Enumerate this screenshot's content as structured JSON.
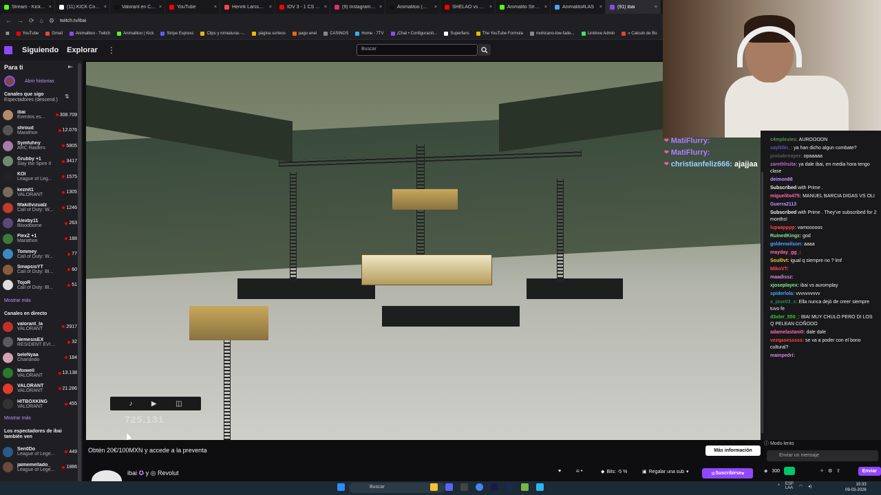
{
  "tabs": [
    {
      "title": "Stream - Kick Da",
      "color": "#53fc18"
    },
    {
      "title": "(11) KICK Comme",
      "color": "#ffffff"
    },
    {
      "title": "Valorant en Chile",
      "color": "#111111"
    },
    {
      "title": "YouTube",
      "color": "#ff0000"
    },
    {
      "title": "Henrik Larsson s",
      "color": "#ff4444"
    },
    {
      "title": "IDV 3 - 1 CS Mu",
      "color": "#ff0000"
    },
    {
      "title": "(9) Instagram • M",
      "color": "#e1306c"
    },
    {
      "title": "Animalitoo (@an",
      "color": "#111111"
    },
    {
      "title": "SHELAO vs CUAR",
      "color": "#ff0000"
    },
    {
      "title": "Animalito Stream",
      "color": "#53fc18"
    },
    {
      "title": "Animalito#LAS",
      "color": "#4aa3ff"
    },
    {
      "title": "(91) ibai",
      "color": "#9147ff"
    }
  ],
  "url": "twitch.tv/ibai",
  "bookmarks": [
    {
      "label": "YouTube",
      "color": "#ff0000"
    },
    {
      "label": "Gmail",
      "color": "#ea4335"
    },
    {
      "label": "Animalitoo - Twitch",
      "color": "#9147ff"
    },
    {
      "label": "Animalitoo | Kick",
      "color": "#53fc18"
    },
    {
      "label": "Stripe Express",
      "color": "#635bff"
    },
    {
      "label": "Clips y miniaturas -...",
      "color": "#f4b400"
    },
    {
      "label": "página sorteos",
      "color": "#f4b400"
    },
    {
      "label": "pago enel",
      "color": "#ff6600"
    },
    {
      "label": "CASINOS",
      "color": "#888888"
    },
    {
      "label": "Home - 7TV",
      "color": "#29b6f6"
    },
    {
      "label": "¡Chat • Configuració...",
      "color": "#9147ff"
    },
    {
      "label": "Superfans",
      "color": "#ffffff"
    },
    {
      "label": "The YouTube Formula",
      "color": "#f4b400"
    },
    {
      "label": "mohicano-low-fade...",
      "color": "#888888"
    },
    {
      "label": "Linktree Admin",
      "color": "#43e660"
    },
    {
      "label": "« Calculo de Bo",
      "color": "#ea4335"
    }
  ],
  "nav": {
    "following": "Siguiendo",
    "explore": "Explorar",
    "search_placeholder": "Buscar"
  },
  "sidebar": {
    "for_you": "Para ti",
    "open_stories": "Abrir historias",
    "followed_title": "Canales que sigo",
    "followed_sort": "Espectadores (descend.)",
    "followed": [
      {
        "name": "ibai",
        "game": "Eventos es...",
        "viewers": "308.709",
        "color": "#b38a6a"
      },
      {
        "name": "shroud",
        "game": "Marathon",
        "viewers": "12.076",
        "color": "#555555"
      },
      {
        "name": "Symfuhny",
        "game": "ARC Raiders",
        "viewers": "5805",
        "color": "#a87ca8"
      },
      {
        "name": "Grubby +1",
        "game": "Slay the Spire II",
        "viewers": "3417",
        "color": "#6e8c6e"
      },
      {
        "name": "KOI",
        "game": "League of Leg...",
        "viewers": "1575",
        "color": "#222222"
      },
      {
        "name": "keznit1",
        "game": "VALORANT",
        "viewers": "1305",
        "color": "#7a6a5a"
      },
      {
        "name": "fifakillvizualz",
        "game": "Call of Duty: W...",
        "viewers": "1246",
        "color": "#c23b2b"
      },
      {
        "name": "Alexby11",
        "game": "Bloodborne",
        "viewers": "263",
        "color": "#5a4a7a"
      },
      {
        "name": "FlexZ +1",
        "game": "Marathon",
        "viewers": "188",
        "color": "#3a7a3a"
      },
      {
        "name": "Tommey",
        "game": "Call of Duty: W...",
        "viewers": "77",
        "color": "#3a8ac2"
      },
      {
        "name": "SinapsisYT",
        "game": "Call of Duty: Bl...",
        "viewers": "60",
        "color": "#8a5a3a"
      },
      {
        "name": "TojoR",
        "game": "Call of Duty: Bl...",
        "viewers": "51",
        "color": "#dddddd"
      }
    ],
    "show_more": "Mostrar más",
    "live_title": "Canales en directo",
    "live": [
      {
        "name": "valorant_la",
        "game": "VALORANT",
        "viewers": "2917",
        "color": "#c2302b"
      },
      {
        "name": "NemesisEX",
        "game": "RESIDENT EVIL...",
        "viewers": "32",
        "color": "#5a5a5a"
      },
      {
        "name": "beleNyaa",
        "game": "Charlando",
        "viewers": "184",
        "color": "#d4a2b8"
      },
      {
        "name": "Mixwell",
        "game": "VALORANT",
        "viewers": "13.138",
        "color": "#2a7a2a"
      },
      {
        "name": "VALORANT",
        "game": "VALORANT",
        "viewers": "21.286",
        "color": "#e6392b"
      },
      {
        "name": "HITBOXKING",
        "game": "VALORANT",
        "viewers": "455",
        "color": "#333333"
      }
    ],
    "show_more2": "Mostrar más",
    "viewers_like": "Los espectadores de ibai también ven",
    "suggested": [
      {
        "name": "Sen0Do",
        "game": "League of Lege...",
        "viewers": "449",
        "color": "#2a5a8a"
      },
      {
        "name": "jaimemellado_",
        "game": "League of Lege...",
        "viewers": "1886",
        "color": "#6a4a3a"
      }
    ]
  },
  "overlay": {
    "count": "725.131"
  },
  "alerts": [
    {
      "user": "MatiFlurry:",
      "msg": "",
      "color": "#b57bff"
    },
    {
      "user": "MatiFlurry:",
      "msg": "",
      "color": "#b57bff"
    },
    {
      "user": "christianfeliz666:",
      "msg": "ajajjaa",
      "color": "#9ad1ff"
    }
  ],
  "chat": [
    {
      "user": "c4mplexies:",
      "text": "AUROOOON",
      "ucolor": "#5a8a5a"
    },
    {
      "user": "sayltilin_:",
      "text": "ya han dicho algun combate?",
      "ucolor": "#5a5aa8"
    },
    {
      "user": "joobabreaper:",
      "text": "opaaaaa",
      "ucolor": "#5a5a5a"
    },
    {
      "user": "zarethhsita:",
      "text": "ya dale ibai, en media hora tengo clase",
      "ucolor": "#b86ec7"
    },
    {
      "user": "deimon88",
      "text": "",
      "ucolor": "#bf94ff"
    },
    {
      "user": "Subscribed",
      "text": "with Prime .",
      "ucolor": "#efeff1"
    },
    {
      "user": "miguelito475:",
      "text": "MANUEL BARCIA DIGAS VS OLI",
      "ucolor": "#ff69b4"
    },
    {
      "user": "Guerra2113",
      "text": "",
      "ucolor": "#bf94ff"
    },
    {
      "user": "Subscribed",
      "text": "with Prime . They've subscribed for 2 months!",
      "ucolor": "#efeff1"
    },
    {
      "user": "lupaapppp:",
      "text": "vamooooos",
      "ucolor": "#ff4444"
    },
    {
      "user": "RuinedKingz:",
      "text": "god",
      "ucolor": "#8be68b"
    },
    {
      "user": "goldenwilson:",
      "text": "aaaa",
      "ucolor": "#4aa3ff"
    },
    {
      "user": "mayday_gg_:",
      "text": "",
      "ucolor": "#ff69b4"
    },
    {
      "user": "Soul0vt:",
      "text": "igual q siempre no ? lmf",
      "ucolor": "#f4c430"
    },
    {
      "user": "MikoVT:",
      "text": "",
      "ucolor": "#ff4444"
    },
    {
      "user": "maadissz:",
      "text": "",
      "ucolor": "#d48ad4"
    },
    {
      "user": "xjoseplayex:",
      "text": "ibai vs auromplay",
      "ucolor": "#8be68b"
    },
    {
      "user": "spiderlola:",
      "text": "vvvvvvvvvv",
      "ucolor": "#4aa3ff"
    },
    {
      "user": "x_jose03_x:",
      "text": "Ella nunca dejó de creer siempre tuvo fe",
      "ucolor": "#2e8b57"
    },
    {
      "user": "d3xter_550_:",
      "text": "IBAI MUY CHULO PERO DI LOS Q PELEAN COÑOOO",
      "ucolor": "#32cd32"
    },
    {
      "user": "adamelastani0:",
      "text": "dale dale",
      "ucolor": "#ff69b4"
    },
    {
      "user": "vezqasesssss:",
      "text": "se va a poder con el bono cultural?",
      "ucolor": "#ff4444"
    },
    {
      "user": "mainpedri:",
      "text": "",
      "ucolor": "#d48ad4"
    }
  ],
  "chat_ui": {
    "slow_mode": "Modo lento",
    "input_placeholder": "Enviar un mensaje",
    "points": "300",
    "send": "Enviar"
  },
  "promo": {
    "text": "Obtén 20€/100MXN y accede a la preventa",
    "more_info": "Más información"
  },
  "channel": {
    "name": "ibai",
    "partner": "y",
    "sponsor": "Revolut",
    "bits": "Bits: -5 %",
    "gift": "Regalar una sub",
    "subscribe": "Suscribirse"
  },
  "taskbar": {
    "search": "Buscar",
    "lang": "ESP",
    "region": "LAA",
    "time": "15:33",
    "date": "09-03-2026"
  },
  "colors": {
    "accent": "#9147ff",
    "live": "#eb0400",
    "bg": "#0e0e10",
    "panel": "#1f1f23"
  }
}
